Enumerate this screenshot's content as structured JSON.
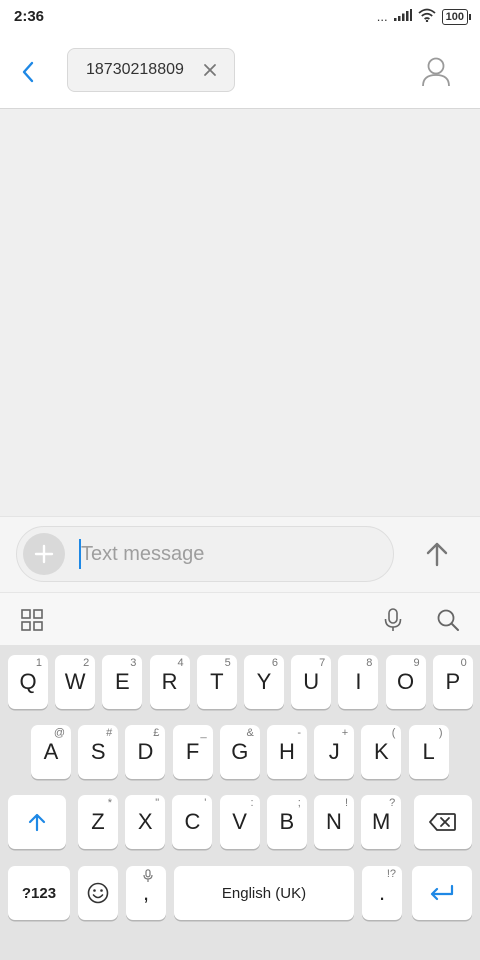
{
  "status_bar": {
    "time": "2:36",
    "signal_dots": "...",
    "battery": "100"
  },
  "header": {
    "recipient": "18730218809"
  },
  "composer": {
    "placeholder": "Text message"
  },
  "keyboard": {
    "row1": [
      {
        "key": "Q",
        "hint": "1"
      },
      {
        "key": "W",
        "hint": "2"
      },
      {
        "key": "E",
        "hint": "3"
      },
      {
        "key": "R",
        "hint": "4"
      },
      {
        "key": "T",
        "hint": "5"
      },
      {
        "key": "Y",
        "hint": "6"
      },
      {
        "key": "U",
        "hint": "7"
      },
      {
        "key": "I",
        "hint": "8"
      },
      {
        "key": "O",
        "hint": "9"
      },
      {
        "key": "P",
        "hint": "0"
      }
    ],
    "row2": [
      {
        "key": "A",
        "hint": "@"
      },
      {
        "key": "S",
        "hint": "#"
      },
      {
        "key": "D",
        "hint": "£"
      },
      {
        "key": "F",
        "hint": "_"
      },
      {
        "key": "G",
        "hint": "&"
      },
      {
        "key": "H",
        "hint": "-"
      },
      {
        "key": "J",
        "hint": "+"
      },
      {
        "key": "K",
        "hint": "("
      },
      {
        "key": "L",
        "hint": ")"
      }
    ],
    "row3": [
      {
        "key": "Z",
        "hint": "*"
      },
      {
        "key": "X",
        "hint": "\""
      },
      {
        "key": "C",
        "hint": "'"
      },
      {
        "key": "V",
        "hint": ":"
      },
      {
        "key": "B",
        "hint": ";"
      },
      {
        "key": "N",
        "hint": "!"
      },
      {
        "key": "M",
        "hint": "?"
      }
    ],
    "symbols_label": "?123",
    "comma": ",",
    "space_label": "English (UK)",
    "period": ".",
    "period_hint": "!?"
  },
  "colors": {
    "accent": "#1e88e5"
  }
}
